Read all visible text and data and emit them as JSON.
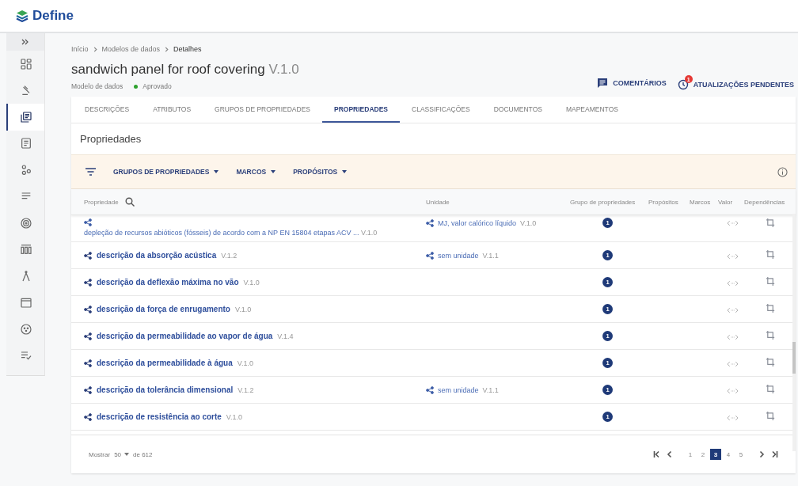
{
  "app": {
    "logo_text": "Define"
  },
  "sidebar": {
    "items": [
      {
        "selected": false
      },
      {
        "selected": false
      },
      {
        "selected": true
      },
      {
        "selected": false
      },
      {
        "selected": false
      },
      {
        "selected": false
      },
      {
        "selected": false
      },
      {
        "selected": false
      },
      {
        "selected": false
      },
      {
        "selected": false
      },
      {
        "selected": false
      },
      {
        "selected": false
      }
    ]
  },
  "breadcrumb": [
    "Início",
    "Modelos de dados",
    "Detalhes"
  ],
  "title": "sandwich panel for roof covering",
  "version": "V.1.0",
  "subtitle": "Modelo de dados",
  "status": "Aprovado",
  "actions": [
    {
      "kind": "comments",
      "label": "COMENTÁRIOS"
    },
    {
      "kind": "updates",
      "label": "ATUALIZAÇÕES PENDENTES",
      "badge": "1"
    }
  ],
  "tabs": [
    {
      "label": "DESCRIÇÕES",
      "selected": false
    },
    {
      "label": "ATRIBUTOS",
      "selected": false
    },
    {
      "label": "GRUPOS DE PROPRIEDADES",
      "selected": false
    },
    {
      "label": "PROPRIEDADES",
      "selected": true
    },
    {
      "label": "CLASSIFICAÇÕES",
      "selected": false
    },
    {
      "label": "DOCUMENTOS",
      "selected": false
    },
    {
      "label": "MAPEAMENTOS",
      "selected": false
    }
  ],
  "section_title": "Propriedades",
  "filters": [
    "GRUPOS DE PROPRIEDADES",
    "MARCOS",
    "PROPÓSITOS"
  ],
  "table": {
    "columns": [
      "Propriedade",
      "Unidade",
      "Grupo de propriedades",
      "Propósitos",
      "Marcos",
      "Valor",
      "Dependências"
    ],
    "rows": [
      {
        "kind": "wrapped",
        "name": "depleção de recursos abióticos (fósseis) de acordo com a NP EN 15804 etapas ACV ...",
        "version": "V.1.0",
        "unit": "MJ, valor calórico líquido",
        "unit_version": "V.1.0",
        "group_count": "1"
      },
      {
        "kind": "normal",
        "name": "descrição da absorção acústica",
        "version": "V.1.2",
        "unit": "sem unidade",
        "unit_version": "V.1.1",
        "group_count": "1"
      },
      {
        "kind": "normal",
        "name": "descrição da deflexão máxima no vão",
        "version": "V.1.0",
        "group_count": "1"
      },
      {
        "kind": "normal",
        "name": "descrição da força de enrugamento",
        "version": "V.1.0",
        "group_count": "1"
      },
      {
        "kind": "normal",
        "name": "descrição da permeabilidade ao vapor de água",
        "version": "V.1.4",
        "group_count": "1"
      },
      {
        "kind": "normal",
        "name": "descrição da permeabilidade à água",
        "version": "V.1.0",
        "group_count": "1"
      },
      {
        "kind": "normal",
        "name": "descrição da tolerância dimensional",
        "version": "V.1.2",
        "unit": "sem unidade",
        "unit_version": "V.1.1",
        "group_count": "1"
      },
      {
        "kind": "normal",
        "name": "descrição de resistência ao corte",
        "version": "V.1.0",
        "group_count": "1"
      }
    ]
  },
  "footer": {
    "show_label": "Mostrar",
    "page_size": "50",
    "total": "de 612",
    "pages": [
      {
        "label": "1",
        "selected": false
      },
      {
        "label": "2",
        "selected": false
      },
      {
        "label": "3",
        "selected": true
      },
      {
        "label": "4",
        "selected": false
      },
      {
        "label": "5",
        "selected": false
      }
    ]
  }
}
